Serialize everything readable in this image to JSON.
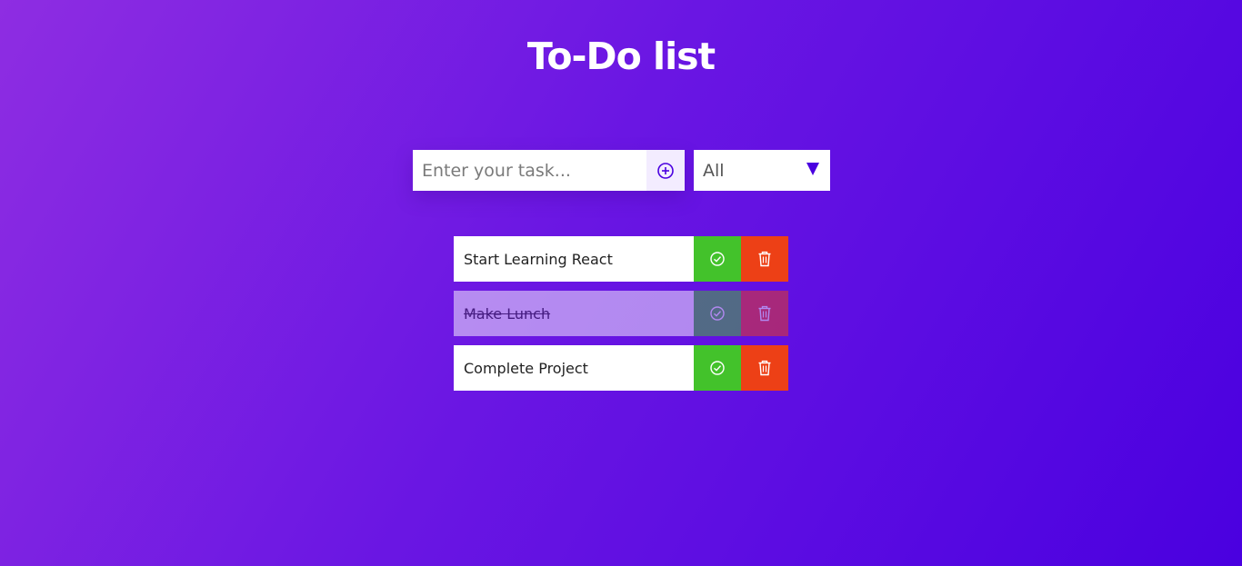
{
  "app": {
    "title": "To-Do list"
  },
  "form": {
    "input_placeholder": "Enter your task...",
    "input_value": "",
    "add_icon": "plus-circle-icon",
    "filter_selected": "All"
  },
  "todos": [
    {
      "text": "Start Learning React",
      "completed": false
    },
    {
      "text": "Make Lunch",
      "completed": true
    },
    {
      "text": "Complete Project",
      "completed": false
    }
  ],
  "icons": {
    "complete": "check-circle-icon",
    "delete": "trash-icon"
  },
  "colors": {
    "gradient_start": "#8e2de2",
    "gradient_end": "#4a00e0",
    "complete_button": "#43c22b",
    "delete_button": "#ed4016",
    "accent": "#4a00e0"
  }
}
